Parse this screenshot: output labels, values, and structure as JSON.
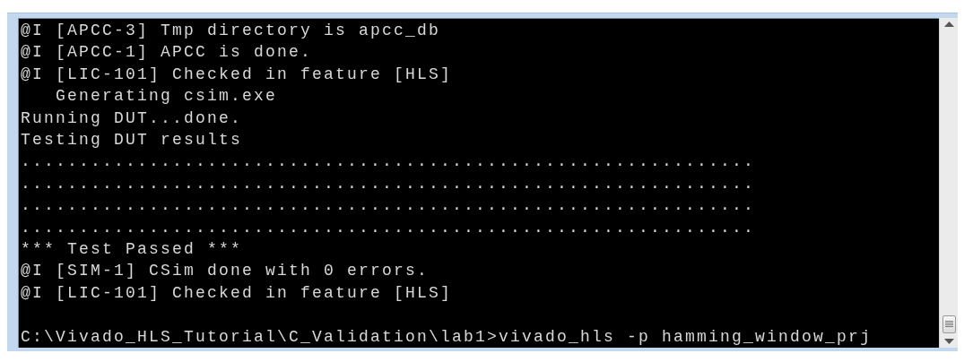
{
  "console": {
    "lines": [
      {
        "kind": "output",
        "text": "@I [APCC-3] Tmp directory is apcc_db"
      },
      {
        "kind": "output",
        "text": "@I [APCC-1] APCC is done."
      },
      {
        "kind": "output",
        "text": "@I [LIC-101] Checked in feature [HLS]"
      },
      {
        "kind": "output",
        "text": "   Generating csim.exe"
      },
      {
        "kind": "output",
        "text": "Running DUT...done."
      },
      {
        "kind": "output",
        "text": "Testing DUT results"
      },
      {
        "kind": "output",
        "text": "..............................................................."
      },
      {
        "kind": "output",
        "text": "..............................................................."
      },
      {
        "kind": "output",
        "text": "..............................................................."
      },
      {
        "kind": "output",
        "text": "..............................................................."
      },
      {
        "kind": "output",
        "text": "*** Test Passed ***"
      },
      {
        "kind": "output",
        "text": "@I [SIM-1] CSim done with 0 errors."
      },
      {
        "kind": "output",
        "text": "@I [LIC-101] Checked in feature [HLS]"
      },
      {
        "kind": "prompt",
        "text": "C:\\Vivado_HLS_Tutorial\\C_Validation\\lab1>vivado_hls -p hamming_window_prj"
      }
    ]
  }
}
